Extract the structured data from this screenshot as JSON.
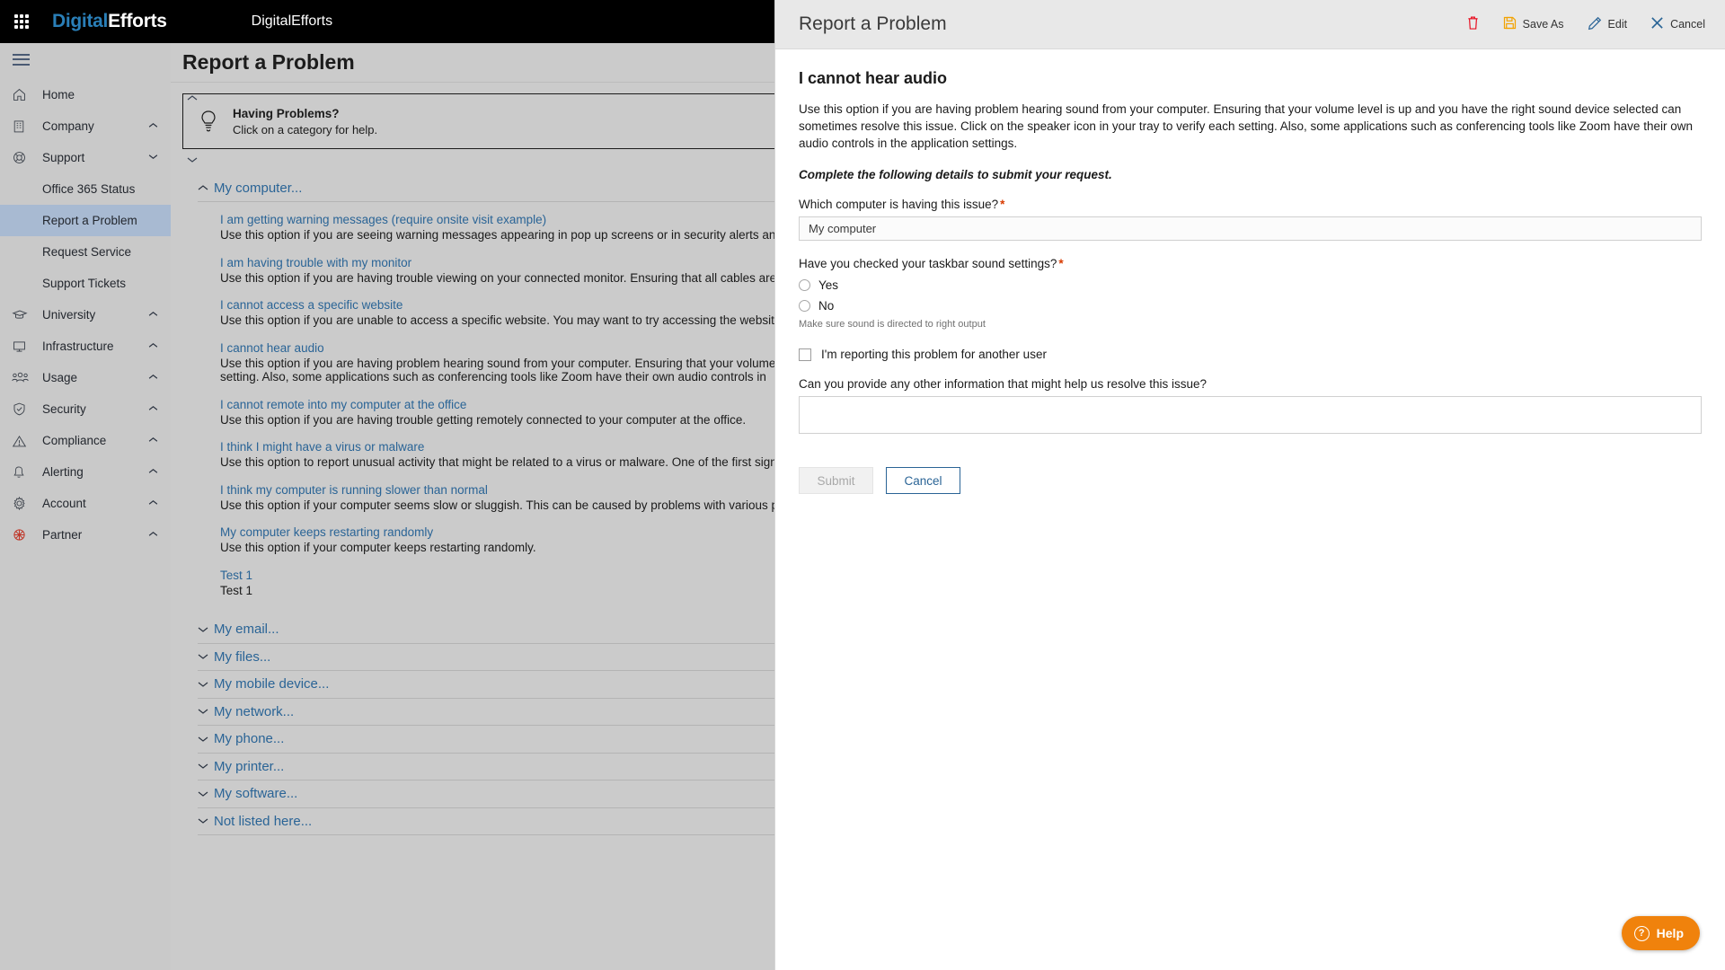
{
  "topbar": {
    "waffle_icon": "app-grid-icon",
    "brand_first": "Digital",
    "brand_second": "Efforts",
    "app_name": "DigitalEfforts"
  },
  "sidebar": {
    "menu_icon": "hamburger-icon",
    "items": [
      {
        "label": "Home",
        "icon": "home-icon",
        "chevron": ""
      },
      {
        "label": "Company",
        "icon": "building-icon",
        "chevron": "^"
      },
      {
        "label": "Support",
        "icon": "lifebuoy-icon",
        "chevron": "v"
      },
      {
        "label": "University",
        "icon": "graduation-cap-icon",
        "chevron": "^"
      },
      {
        "label": "Infrastructure",
        "icon": "monitor-icon",
        "chevron": "^"
      },
      {
        "label": "Usage",
        "icon": "people-icon",
        "chevron": "^"
      },
      {
        "label": "Security",
        "icon": "shield-check-icon",
        "chevron": "^"
      },
      {
        "label": "Compliance",
        "icon": "warning-triangle-icon",
        "chevron": "^"
      },
      {
        "label": "Alerting",
        "icon": "bell-icon",
        "chevron": "^"
      },
      {
        "label": "Account",
        "icon": "gear-icon",
        "chevron": "^"
      },
      {
        "label": "Partner",
        "icon": "partner-icon",
        "chevron": "^"
      }
    ],
    "support_sub": [
      {
        "label": "Office 365 Status",
        "active": false
      },
      {
        "label": "Report a Problem",
        "active": true
      },
      {
        "label": "Request Service",
        "active": false
      },
      {
        "label": "Support Tickets",
        "active": false
      }
    ]
  },
  "page": {
    "title": "Report a Problem",
    "hint": {
      "icon": "lightbulb-icon",
      "title": "Having Problems?",
      "subtitle": "Click on a category for help."
    }
  },
  "categories": {
    "expanded": {
      "label": "My computer...",
      "caret": "^",
      "problems": [
        {
          "link": "I am getting warning messages (require onsite visit example)",
          "desc": "Use this option if you are seeing warning messages appearing in pop up screens or in security alerts and want us to investigate."
        },
        {
          "link": "I am having trouble with my monitor",
          "desc": "Use this option if you are having trouble viewing on your connected monitor. Ensuring that all cables are connected securely can som"
        },
        {
          "link": "I cannot access a specific website",
          "desc": "Use this option if you are unable to access a specific website. You may want to try accessing the website from a different web browser"
        },
        {
          "link": "I cannot hear audio",
          "desc": "Use this option if you are having problem hearing sound from your computer. Ensuring that your volume level is up and you have the icon in your tray to verify each setting. Also, some applications such as conferencing tools like Zoom have their own audio controls in"
        },
        {
          "link": "I cannot remote into my computer at the office",
          "desc": "Use this option if you are having trouble getting remotely connected to your computer at the office."
        },
        {
          "link": "I think I might have a virus or malware",
          "desc": "Use this option to report unusual activity that might be related to a virus or malware. One of the first signs of these problems is stran select."
        },
        {
          "link": "I think my computer is running slower than normal",
          "desc": "Use this option if your computer seems slow or sluggish. This can be caused by problems with various programs or settings. Most tim"
        },
        {
          "link": "My computer keeps restarting randomly",
          "desc": "Use this option if your computer keeps restarting randomly."
        },
        {
          "link": "Test 1",
          "desc": "Test 1"
        }
      ]
    },
    "collapsed": [
      {
        "label": "My email...",
        "caret": "v"
      },
      {
        "label": "My files...",
        "caret": "v"
      },
      {
        "label": "My mobile device...",
        "caret": "v"
      },
      {
        "label": "My network...",
        "caret": "v"
      },
      {
        "label": "My phone...",
        "caret": "v"
      },
      {
        "label": "My printer...",
        "caret": "v"
      },
      {
        "label": "My software...",
        "caret": "v"
      },
      {
        "label": "Not listed here...",
        "caret": "v"
      }
    ]
  },
  "drawer": {
    "title": "Report a Problem",
    "toolbar": {
      "delete_icon": "trash-icon",
      "save_as_label": "Save As",
      "save_as_icon": "floppy-disk-icon",
      "edit_label": "Edit",
      "edit_icon": "pencil-icon",
      "cancel_label": "Cancel",
      "cancel_icon": "close-x-icon"
    },
    "issue_title": "I cannot hear audio",
    "issue_desc": "Use this option if you are having problem hearing sound from your computer. Ensuring that your volume level is up and you have the right sound device selected can sometimes resolve this issue. Click on the speaker icon in your tray to verify each setting. Also, some applications such as conferencing tools like Zoom have their own audio controls in the application settings.",
    "issue_note": "Complete the following details to submit your request.",
    "form": {
      "computer_label": "Which computer is having this issue?",
      "computer_required": "*",
      "computer_value": "My computer",
      "taskbar_label": "Have you checked your taskbar sound settings?",
      "taskbar_required": "*",
      "radio_yes": "Yes",
      "radio_no": "No",
      "helper_text": "Make sure sound is directed to right output",
      "another_user_label": "I'm reporting this problem for another user",
      "other_info_label": "Can you provide any other information that might help us resolve this issue?",
      "other_info_value": "",
      "submit_label": "Submit",
      "cancel_label": "Cancel"
    }
  },
  "help": {
    "label": "Help",
    "icon": "question-circle-icon"
  },
  "colors": {
    "accent_blue": "#2a6496",
    "brand_blue": "#2a7fb8",
    "required_red": "#d83b01",
    "delete_red": "#e81123",
    "save_orange": "#f2a200",
    "help_orange": "#f0820c",
    "active_nav": "#a8bad2"
  }
}
